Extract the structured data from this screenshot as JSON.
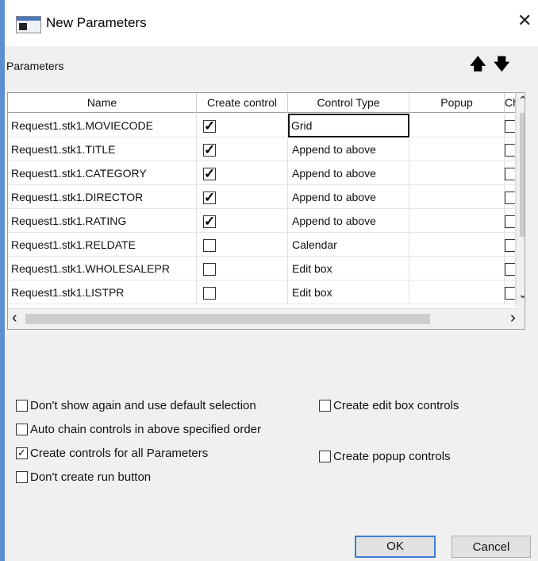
{
  "window": {
    "title": "New Parameters",
    "close_glyph": "✕"
  },
  "section": {
    "label": "Parameters"
  },
  "move": {
    "up_glyph": "🡅",
    "down_glyph": "🡇"
  },
  "table": {
    "headers": [
      "Name",
      "Create control",
      "Control Type",
      "Popup",
      "Ch"
    ],
    "rows": [
      {
        "name": "Request1.stk1.MOVIECODE",
        "create": true,
        "type": "Grid"
      },
      {
        "name": "Request1.stk1.TITLE",
        "create": true,
        "type": "Append to above"
      },
      {
        "name": "Request1.stk1.CATEGORY",
        "create": true,
        "type": "Append to above"
      },
      {
        "name": "Request1.stk1.DIRECTOR",
        "create": true,
        "type": "Append to above"
      },
      {
        "name": "Request1.stk1.RATING",
        "create": true,
        "type": "Append to above"
      },
      {
        "name": "Request1.stk1.RELDATE",
        "create": false,
        "type": "Calendar"
      },
      {
        "name": "Request1.stk1.WHOLESALEPR",
        "create": false,
        "type": "Edit box"
      },
      {
        "name": "Request1.stk1.LISTPR",
        "create": false,
        "type": "Edit box"
      }
    ]
  },
  "scroll": {
    "up": "⌃",
    "down": "⌄",
    "left": "‹",
    "right": "›"
  },
  "options": {
    "dont_show": {
      "label": "Don't show again and use default selection",
      "checked": false
    },
    "auto_chain": {
      "label": "Auto chain controls in above specified order",
      "checked": false
    },
    "create_all": {
      "label": "Create controls for all Parameters",
      "checked": true
    },
    "no_run_button": {
      "label": "Don't create run button",
      "checked": false
    },
    "edit_box_controls": {
      "label": "Create edit box controls",
      "checked": false
    },
    "popup_controls": {
      "label": "Create popup controls",
      "checked": false
    }
  },
  "buttons": {
    "ok": "OK",
    "cancel": "Cancel"
  },
  "check_glyph": "✓"
}
